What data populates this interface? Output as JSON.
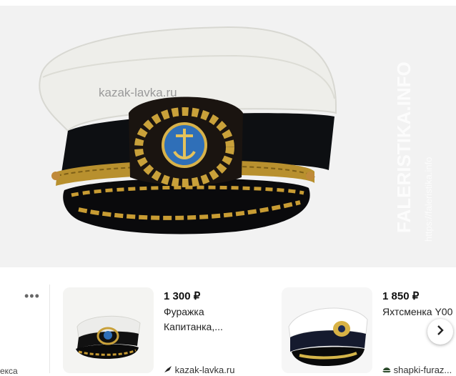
{
  "hero": {
    "watermark": "kazak-lavka.ru",
    "side_watermark_big": "FALERISTIKA.INFO",
    "side_watermark_small": "https://faleristika.info"
  },
  "strip": {
    "more_label": "•••",
    "left_source": "екса"
  },
  "cards": [
    {
      "price": "1 300 ₽",
      "title_line1": "Фуражка",
      "title_line2": "Капитанка,...",
      "source": "kazak-lavka.ru"
    },
    {
      "price": "1 850 ₽",
      "title_line1": "Яхтсменка Y00",
      "source": "shapki-furaz..."
    }
  ],
  "icons": {
    "next": "chevron-right-icon",
    "source1": "leaf-icon",
    "source2": "cap-icon"
  }
}
